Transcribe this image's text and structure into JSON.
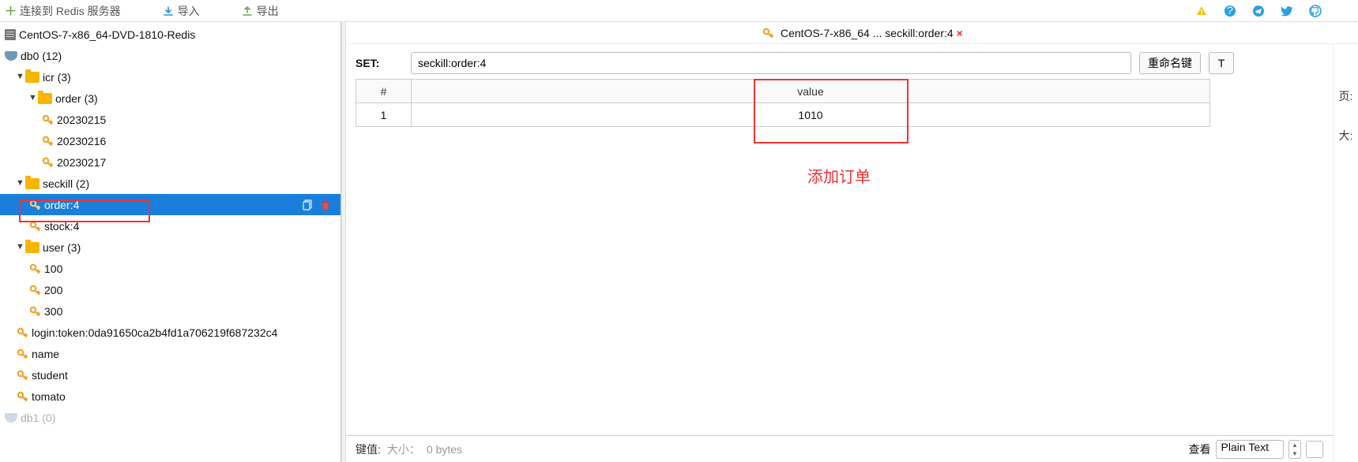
{
  "toolbar": {
    "connect_label": "连接到 Redis 服务器",
    "import_label": "导入",
    "export_label": "导出"
  },
  "sidebar": {
    "server": "CentOS-7-x86_64-DVD-1810-Redis",
    "db": "db0  (12)",
    "folders": {
      "icr": {
        "label": "icr (3)",
        "children": {
          "order": {
            "label": "order (3)",
            "keys": [
              "20230215",
              "20230216",
              "20230217"
            ]
          }
        }
      },
      "seckill": {
        "label": "seckill (2)",
        "keys": [
          "order:4",
          "stock:4"
        ]
      },
      "user": {
        "label": "user (3)",
        "keys": [
          "100",
          "200",
          "300"
        ]
      }
    },
    "keys": [
      "login:token:0da91650ca2b4fd1a706219f687232c4",
      "name",
      "student",
      "tomato"
    ],
    "db1": "db1  (0)"
  },
  "tab": {
    "title": "CentOS-7-x86_64 ... seckill:order:4"
  },
  "editor": {
    "type_label": "SET:",
    "key_value": "seckill:order:4",
    "rename_btn": "重命名键",
    "t_btn": "T",
    "table": {
      "idx_header": "#",
      "val_header": "value",
      "rows": [
        {
          "idx": "1",
          "value": "1010"
        }
      ]
    },
    "added_label": "添加订单"
  },
  "rail": {
    "page": "页:",
    "size": "大:"
  },
  "valuebar": {
    "label": "键值:",
    "size_label": "大小：",
    "size_value": "0 bytes",
    "view_label": "查看",
    "view_mode": "Plain Text"
  }
}
